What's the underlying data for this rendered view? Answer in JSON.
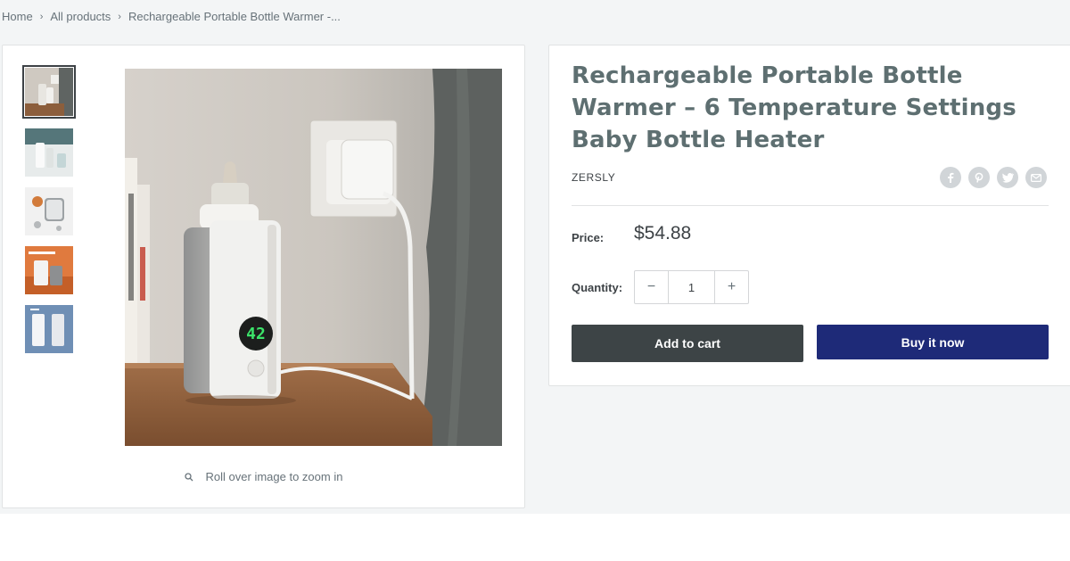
{
  "breadcrumb": {
    "home": "Home",
    "all_products": "All products",
    "current": "Rechargeable Portable Bottle Warmer -..."
  },
  "gallery": {
    "thumbnails": [
      "thumbnail-1",
      "thumbnail-2",
      "thumbnail-3",
      "thumbnail-4",
      "thumbnail-5"
    ],
    "active_index": 0,
    "display_digits": "42",
    "zoom_hint": "Roll over image to zoom in"
  },
  "product": {
    "title": "Rechargeable Portable Bottle Warmer – 6 Temperature Settings Baby Bottle Heater",
    "vendor": "ZERSLY",
    "price_label": "Price:",
    "price": "$54.88",
    "quantity_label": "Quantity:",
    "quantity_value": "1",
    "minus": "−",
    "plus": "+",
    "add_to_cart": "Add to cart",
    "buy_now": "Buy it now"
  },
  "share_icons": [
    "facebook-icon",
    "pinterest-icon",
    "twitter-icon",
    "email-icon"
  ],
  "colors": {
    "title": "#5e6f71",
    "add_to_cart_bg": "#3d4446",
    "buy_now_bg": "#1e2a78",
    "page_bg": "#f3f5f6"
  }
}
